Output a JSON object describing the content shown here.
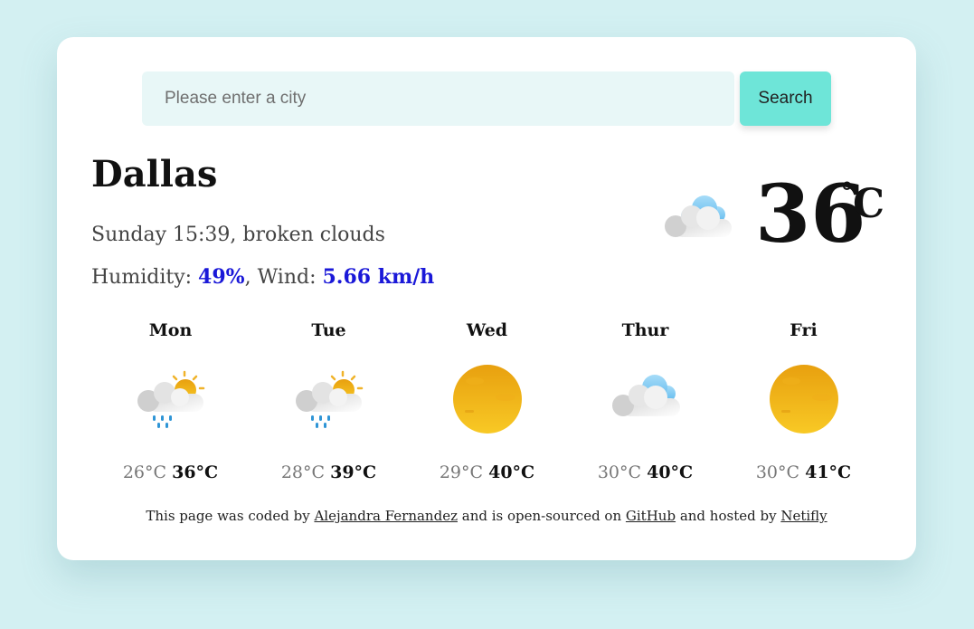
{
  "search": {
    "placeholder": "Please enter a city",
    "button_label": "Search"
  },
  "current": {
    "city": "Dallas",
    "description": "Sunday 15:39, broken clouds",
    "humidity_label": "Humidity: ",
    "humidity_value": "49%",
    "wind_label": ", Wind: ",
    "wind_value": "5.66 km/h",
    "temperature": "36",
    "degree_symbol": "°",
    "unit": "C",
    "icon": "broken-clouds-icon"
  },
  "forecast": [
    {
      "day": "Mon",
      "min": "26°C",
      "max": "36°C",
      "icon": "sun-rain-icon"
    },
    {
      "day": "Tue",
      "min": "28°C",
      "max": "39°C",
      "icon": "sun-rain-icon"
    },
    {
      "day": "Wed",
      "min": "29°C",
      "max": "40°C",
      "icon": "sun-icon"
    },
    {
      "day": "Thur",
      "min": "30°C",
      "max": "40°C",
      "icon": "broken-clouds-icon"
    },
    {
      "day": "Fri",
      "min": "30°C",
      "max": "41°C",
      "icon": "sun-icon"
    }
  ],
  "footer": {
    "text1": "This page was coded by ",
    "author_link": "Alejandra Fernandez",
    "text2": " and is open-sourced on ",
    "github_link": "GitHub",
    "text3": " and hosted by ",
    "host_link": "Netifly"
  },
  "colors": {
    "background": "#d3f0f2",
    "button": "#6ee5d8",
    "input": "#e8f7f7",
    "accent": "#1a18d8"
  }
}
